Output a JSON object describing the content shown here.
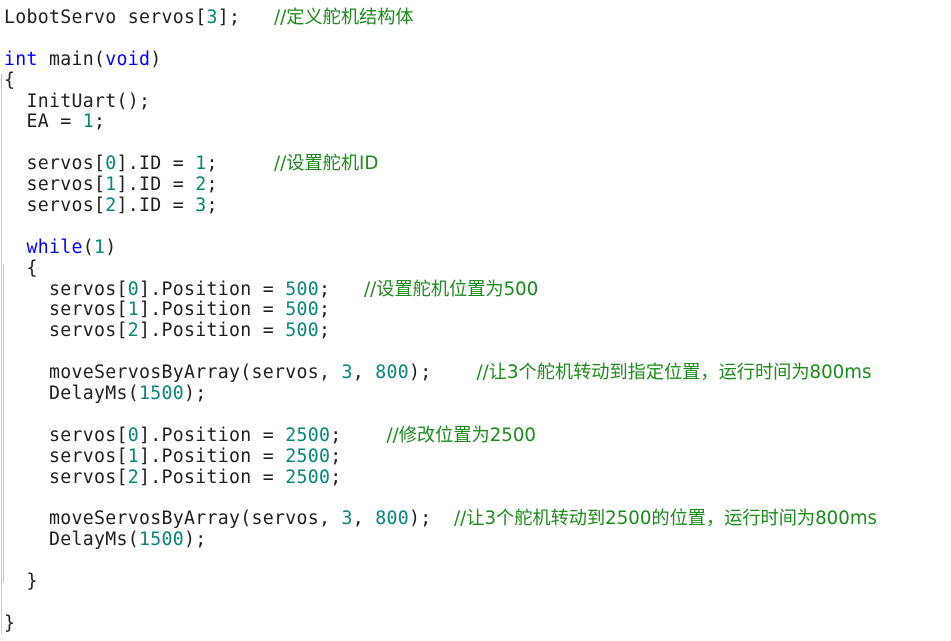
{
  "lines": [
    {
      "parts": [
        {
          "t": "LobotServo servos[",
          "c": "op"
        },
        {
          "t": "3",
          "c": "num"
        },
        {
          "t": "];   ",
          "c": "op"
        },
        {
          "t": "//定义舵机结构体",
          "c": "cm"
        }
      ]
    },
    {
      "parts": []
    },
    {
      "parts": [
        {
          "t": "int",
          "c": "kw"
        },
        {
          "t": " main(",
          "c": "op"
        },
        {
          "t": "void",
          "c": "kw"
        },
        {
          "t": ")",
          "c": "op"
        }
      ]
    },
    {
      "parts": [
        {
          "t": "{",
          "c": "op"
        }
      ]
    },
    {
      "parts": [
        {
          "t": "  InitUart();",
          "c": "op"
        }
      ]
    },
    {
      "parts": [
        {
          "t": "  EA = ",
          "c": "op"
        },
        {
          "t": "1",
          "c": "num"
        },
        {
          "t": ";",
          "c": "op"
        }
      ]
    },
    {
      "parts": []
    },
    {
      "parts": [
        {
          "t": "  servos[",
          "c": "op"
        },
        {
          "t": "0",
          "c": "num"
        },
        {
          "t": "].ID = ",
          "c": "op"
        },
        {
          "t": "1",
          "c": "num"
        },
        {
          "t": ";     ",
          "c": "op"
        },
        {
          "t": "//设置舵机ID",
          "c": "cm"
        }
      ]
    },
    {
      "parts": [
        {
          "t": "  servos[",
          "c": "op"
        },
        {
          "t": "1",
          "c": "num"
        },
        {
          "t": "].ID = ",
          "c": "op"
        },
        {
          "t": "2",
          "c": "num"
        },
        {
          "t": ";",
          "c": "op"
        }
      ]
    },
    {
      "parts": [
        {
          "t": "  servos[",
          "c": "op"
        },
        {
          "t": "2",
          "c": "num"
        },
        {
          "t": "].ID = ",
          "c": "op"
        },
        {
          "t": "3",
          "c": "num"
        },
        {
          "t": ";",
          "c": "op"
        }
      ]
    },
    {
      "parts": []
    },
    {
      "parts": [
        {
          "t": "  ",
          "c": "op"
        },
        {
          "t": "while",
          "c": "kw"
        },
        {
          "t": "(",
          "c": "op"
        },
        {
          "t": "1",
          "c": "num"
        },
        {
          "t": ")",
          "c": "op"
        }
      ]
    },
    {
      "parts": [
        {
          "t": "  {",
          "c": "op"
        }
      ]
    },
    {
      "parts": [
        {
          "t": "    servos[",
          "c": "op"
        },
        {
          "t": "0",
          "c": "num"
        },
        {
          "t": "].Position = ",
          "c": "op"
        },
        {
          "t": "500",
          "c": "num"
        },
        {
          "t": ";   ",
          "c": "op"
        },
        {
          "t": "//设置舵机位置为500",
          "c": "cm"
        }
      ]
    },
    {
      "parts": [
        {
          "t": "    servos[",
          "c": "op"
        },
        {
          "t": "1",
          "c": "num"
        },
        {
          "t": "].Position = ",
          "c": "op"
        },
        {
          "t": "500",
          "c": "num"
        },
        {
          "t": ";",
          "c": "op"
        }
      ]
    },
    {
      "parts": [
        {
          "t": "    servos[",
          "c": "op"
        },
        {
          "t": "2",
          "c": "num"
        },
        {
          "t": "].Position = ",
          "c": "op"
        },
        {
          "t": "500",
          "c": "num"
        },
        {
          "t": ";",
          "c": "op"
        }
      ]
    },
    {
      "parts": []
    },
    {
      "parts": [
        {
          "t": "    moveServosByArray(servos, ",
          "c": "op"
        },
        {
          "t": "3",
          "c": "num"
        },
        {
          "t": ", ",
          "c": "op"
        },
        {
          "t": "800",
          "c": "num"
        },
        {
          "t": ");    ",
          "c": "op"
        },
        {
          "t": "//让3个舵机转动到指定位置，运行时间为800ms",
          "c": "cm"
        }
      ]
    },
    {
      "parts": [
        {
          "t": "    DelayMs(",
          "c": "op"
        },
        {
          "t": "1500",
          "c": "num"
        },
        {
          "t": ");",
          "c": "op"
        }
      ]
    },
    {
      "parts": []
    },
    {
      "parts": [
        {
          "t": "    servos[",
          "c": "op"
        },
        {
          "t": "0",
          "c": "num"
        },
        {
          "t": "].Position = ",
          "c": "op"
        },
        {
          "t": "2500",
          "c": "num"
        },
        {
          "t": ";    ",
          "c": "op"
        },
        {
          "t": "//修改位置为2500",
          "c": "cm"
        }
      ]
    },
    {
      "parts": [
        {
          "t": "    servos[",
          "c": "op"
        },
        {
          "t": "1",
          "c": "num"
        },
        {
          "t": "].Position = ",
          "c": "op"
        },
        {
          "t": "2500",
          "c": "num"
        },
        {
          "t": ";",
          "c": "op"
        }
      ]
    },
    {
      "parts": [
        {
          "t": "    servos[",
          "c": "op"
        },
        {
          "t": "2",
          "c": "num"
        },
        {
          "t": "].Position = ",
          "c": "op"
        },
        {
          "t": "2500",
          "c": "num"
        },
        {
          "t": ";",
          "c": "op"
        }
      ]
    },
    {
      "parts": []
    },
    {
      "parts": [
        {
          "t": "    moveServosByArray(servos, ",
          "c": "op"
        },
        {
          "t": "3",
          "c": "num"
        },
        {
          "t": ", ",
          "c": "op"
        },
        {
          "t": "800",
          "c": "num"
        },
        {
          "t": ");  ",
          "c": "op"
        },
        {
          "t": "//让3个舵机转动到2500的位置，运行时间为800ms",
          "c": "cm"
        }
      ]
    },
    {
      "parts": [
        {
          "t": "    DelayMs(",
          "c": "op"
        },
        {
          "t": "1500",
          "c": "num"
        },
        {
          "t": ");",
          "c": "op"
        }
      ]
    },
    {
      "parts": []
    },
    {
      "parts": [
        {
          "t": "  }",
          "c": "op"
        }
      ]
    },
    {
      "parts": []
    },
    {
      "parts": [
        {
          "t": "}",
          "c": "op"
        }
      ]
    }
  ],
  "colors": {
    "keyword": "#0000ff",
    "number": "#098677",
    "comment": "#1d8a1d",
    "text": "#1e1e1e",
    "background": "#ffffff"
  }
}
